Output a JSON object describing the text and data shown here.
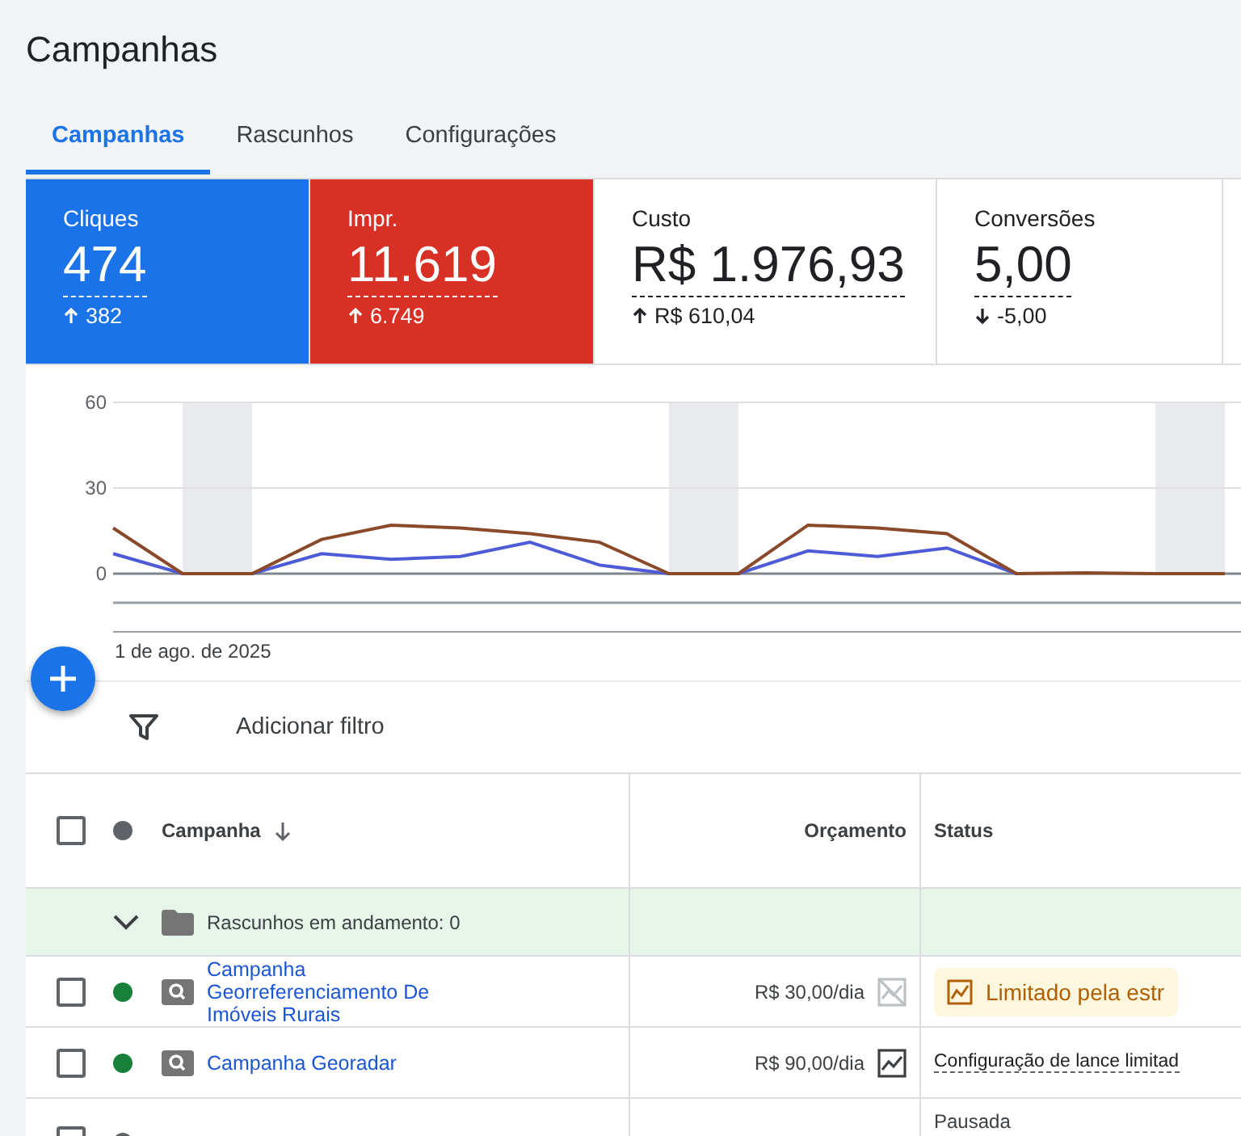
{
  "page_title": "Campanhas",
  "tabs": [
    {
      "label": "Campanhas",
      "selected": true
    },
    {
      "label": "Rascunhos",
      "selected": false
    },
    {
      "label": "Configurações",
      "selected": false
    }
  ],
  "metrics": [
    {
      "label": "Cliques",
      "value": "474",
      "change": "382",
      "kind": "increase",
      "selected": true,
      "color": "#1a73e8"
    },
    {
      "label": "Impr.",
      "value": "11.619",
      "change": "6.749",
      "kind": "increase",
      "selected": true,
      "color": "#d93025"
    },
    {
      "label": "Custo",
      "value": "R$ 1.976,93",
      "change": "R$ 610,04",
      "kind": "increase",
      "selected": false
    },
    {
      "label": "Conversões",
      "value": "5,00",
      "change": "-5,00",
      "kind": "decrease",
      "selected": false
    }
  ],
  "chart": {
    "date_label": "1 de ago. de 2025",
    "chart_data": {
      "type": "line",
      "ylim": [
        0,
        60
      ],
      "yticks": [
        0,
        30,
        60
      ],
      "series": [
        {
          "color": "#4e5bd6",
          "values": [
            7,
            0,
            0,
            7,
            5,
            6,
            11,
            3,
            0,
            0,
            8,
            6,
            9,
            0,
            null,
            null,
            null
          ]
        },
        {
          "color": "#8a4a2a",
          "values": [
            16,
            0,
            0,
            12,
            17,
            16,
            14,
            11,
            0,
            0,
            17,
            16,
            14,
            0,
            0.3,
            0,
            0
          ]
        }
      ]
    }
  },
  "filter": {
    "label": "Adicionar filtro"
  },
  "table": {
    "select_all_checked": false,
    "columns": [
      "Campanha",
      "Orçamento",
      "Status"
    ],
    "group": {
      "label": "Rascunhos em andamento: 0",
      "expanded": true
    },
    "rows": [
      {
        "checked": false,
        "name": "Campanha Georreferenciamento De Imóveis Rurais",
        "color": "#188038",
        "budget": "R$ 30,00/dia",
        "budget_chart": false,
        "status": {
          "kind": "badge",
          "text": "Limitado pela estr"
        }
      },
      {
        "checked": false,
        "name": "Campanha Georadar",
        "color": "#188038",
        "budget": "R$ 90,00/dia",
        "budget_chart": true,
        "status": {
          "kind": "link",
          "text": "Configuração de lance limitad"
        }
      },
      {
        "checked": false,
        "color": "#5f6368",
        "status": {
          "kind": "text",
          "text": "Pausada"
        }
      }
    ]
  }
}
